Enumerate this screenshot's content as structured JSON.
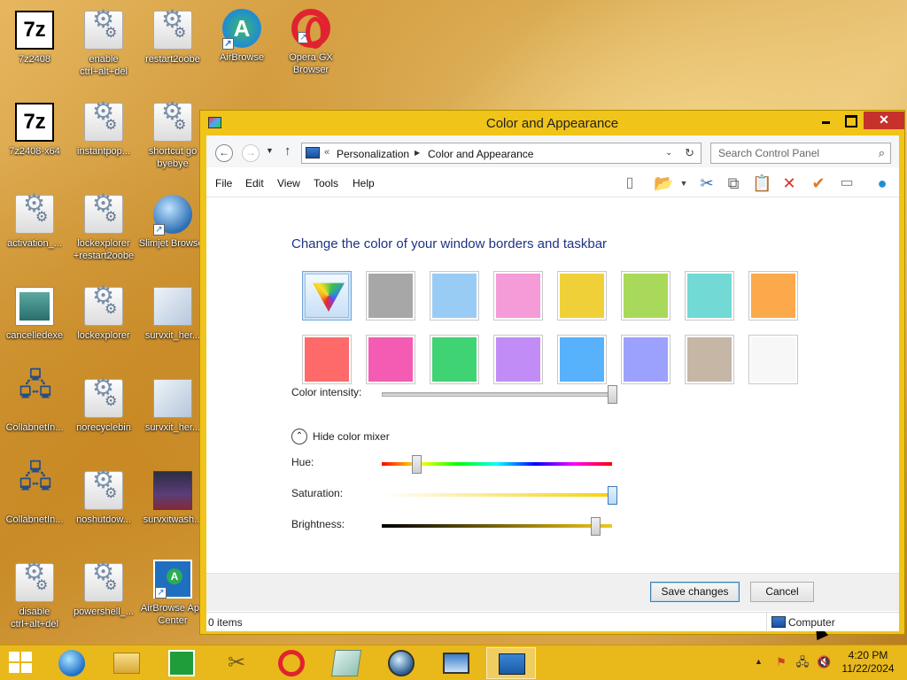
{
  "desktop": {
    "icons": [
      {
        "label": "7z2408",
        "icon": "7zip-icon"
      },
      {
        "label": "enable ctrl+alt+del",
        "icon": "script-gear-icon"
      },
      {
        "label": "restart2oobe",
        "icon": "script-gear-icon"
      },
      {
        "label": "AirBrowse",
        "icon": "airbrowse-icon"
      },
      {
        "label": "Opera GX Browser",
        "icon": "opera-gx-icon"
      },
      {
        "label": "7z2408-x64",
        "icon": "7zip-icon"
      },
      {
        "label": "instantpop...",
        "icon": "script-gear-icon"
      },
      {
        "label": "shortcut go byebye",
        "icon": "script-gear-icon"
      },
      {
        "label": "activation_...",
        "icon": "script-gear-icon"
      },
      {
        "label": "lockexplorer +restart2oobe",
        "icon": "script-gear-icon"
      },
      {
        "label": "Slimjet Browser",
        "icon": "slimjet-icon"
      },
      {
        "label": "cancelledexe",
        "icon": "window-app-icon"
      },
      {
        "label": "lockexplorer",
        "icon": "script-gear-icon"
      },
      {
        "label": "survxit_her...",
        "icon": "survxit-icon"
      },
      {
        "label": "CollabnetIn...",
        "icon": "network-computer-icon"
      },
      {
        "label": "norecyclebin",
        "icon": "script-gear-icon"
      },
      {
        "label": "survxit_her...",
        "icon": "survxit-icon"
      },
      {
        "label": "CollabnetIn...",
        "icon": "network-computer-icon"
      },
      {
        "label": "noshutdow...",
        "icon": "script-gear-icon"
      },
      {
        "label": "survxitwash...",
        "icon": "survxit-wash-icon"
      },
      {
        "label": "disable ctrl+alt+del",
        "icon": "script-gear-icon"
      },
      {
        "label": "powershell_...",
        "icon": "script-gear-icon"
      },
      {
        "label": "AirBrowse App Center",
        "icon": "airbrowse-app-center-icon"
      }
    ]
  },
  "window": {
    "title": "Color and Appearance",
    "title_bar_color": "#f0c419",
    "breadcrumb": {
      "prefix": "«",
      "items": [
        "Personalization",
        "Color and Appearance"
      ]
    },
    "search_placeholder": "Search Control Panel",
    "menu": [
      "File",
      "Edit",
      "View",
      "Tools",
      "Help"
    ],
    "toolbar_icons": [
      "layout-icon",
      "properties-icon",
      "cut-icon",
      "copy-icon",
      "paste-icon",
      "delete-icon",
      "checkmark-icon",
      "rename-icon",
      "network-globe-icon"
    ],
    "heading": "Change the color of your window borders and taskbar",
    "swatches": [
      {
        "name": "automatic",
        "color": "#cfe4f7",
        "selected": true
      },
      {
        "name": "gray",
        "color": "#a7a7a7"
      },
      {
        "name": "light-blue",
        "color": "#99ccf5"
      },
      {
        "name": "pink",
        "color": "#f59bd8"
      },
      {
        "name": "yellow",
        "color": "#f0d038"
      },
      {
        "name": "lime",
        "color": "#a9d95a"
      },
      {
        "name": "teal",
        "color": "#72d9d4"
      },
      {
        "name": "orange",
        "color": "#fba94b"
      },
      {
        "name": "red",
        "color": "#fe6a6a"
      },
      {
        "name": "magenta",
        "color": "#f45bb2"
      },
      {
        "name": "green",
        "color": "#3fd374"
      },
      {
        "name": "violet",
        "color": "#c28cf6"
      },
      {
        "name": "blue",
        "color": "#58b1fb"
      },
      {
        "name": "periwinkle",
        "color": "#9ca1fd"
      },
      {
        "name": "taupe",
        "color": "#c6b6a6"
      },
      {
        "name": "white",
        "color": "#f7f7f7"
      }
    ],
    "color_intensity": {
      "label": "Color intensity:",
      "value": 1.0
    },
    "mixer_toggle_label": "Hide color mixer",
    "hue": {
      "label": "Hue:",
      "value": 0.15
    },
    "saturation": {
      "label": "Saturation:",
      "value": 1.0
    },
    "brightness": {
      "label": "Brightness:",
      "value": 0.93
    },
    "save_label": "Save changes",
    "cancel_label": "Cancel",
    "status_items": "0 items",
    "status_zone": "Computer"
  },
  "taskbar": {
    "color": "#e9b81a",
    "apps": [
      "internet-explorer-icon",
      "file-explorer-icon",
      "store-icon",
      "tools-icon",
      "opera-gx-icon",
      "notepad-icon",
      "browser-globe-icon",
      "photos-icon",
      "control-panel-icon"
    ],
    "active_app": "control-panel-icon",
    "time": "4:20 PM",
    "date": "11/22/2024"
  }
}
